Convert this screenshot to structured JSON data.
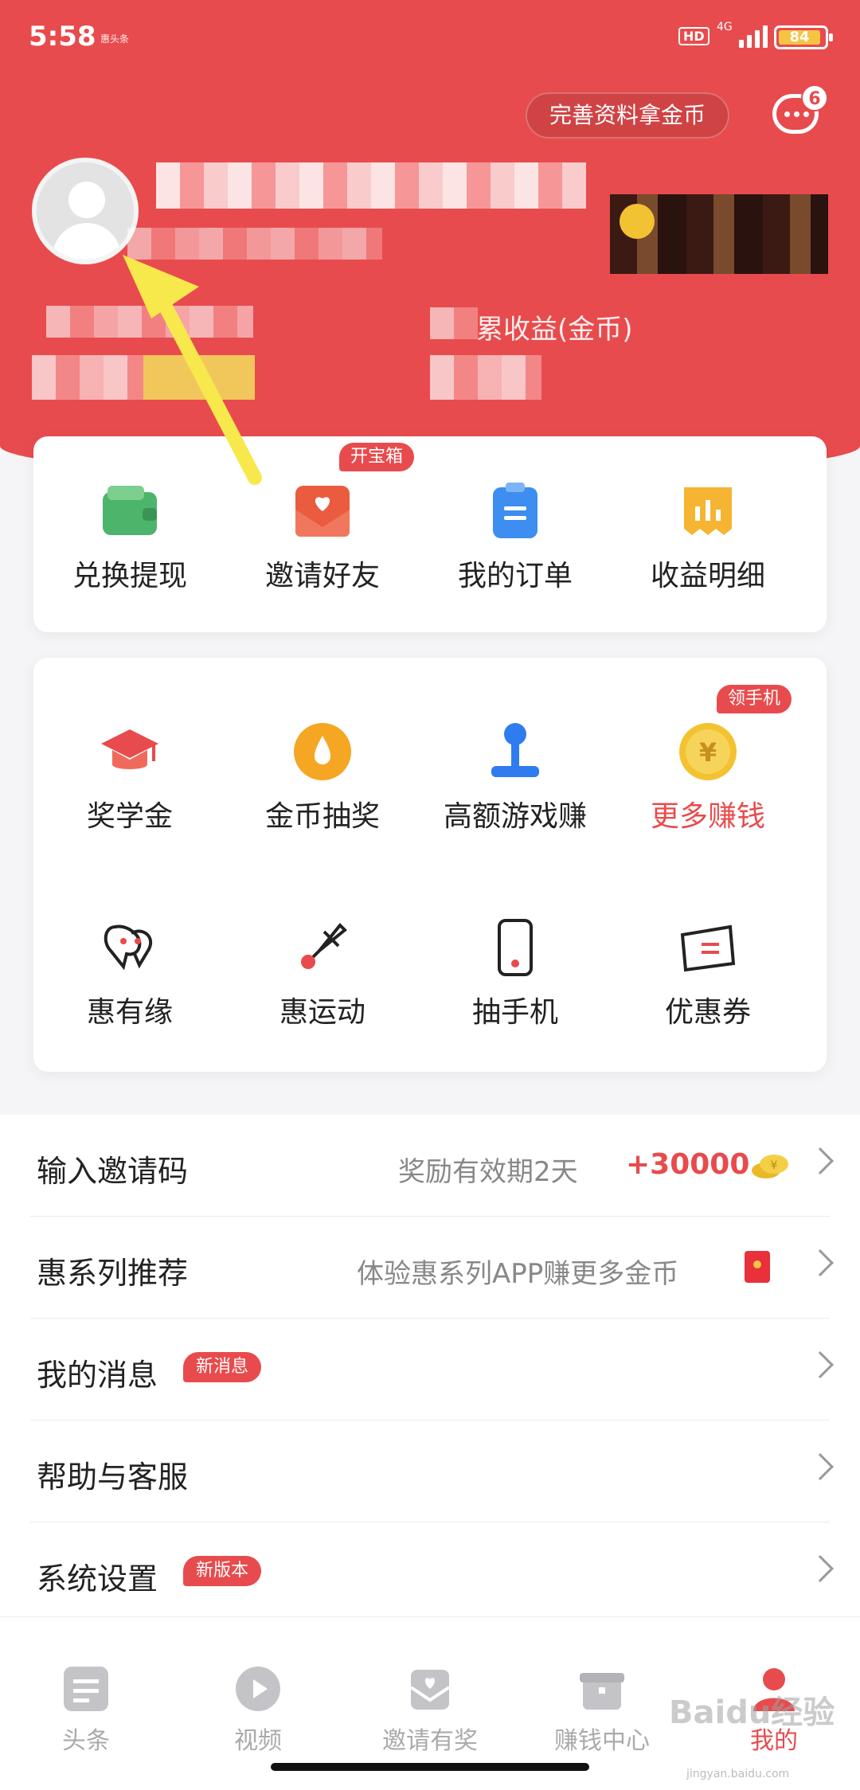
{
  "status_bar": {
    "time": "5:58",
    "carrier_note": "惠头条",
    "hd": "HD",
    "network": "4G",
    "battery": "84"
  },
  "header": {
    "complete_profile_label": "完善资料拿金币",
    "message_count": "6",
    "earnings_label": "累收益(金币)"
  },
  "quick_actions": [
    {
      "label": "兑换提现",
      "icon": "wallet-icon"
    },
    {
      "label": "邀请好友",
      "icon": "envelope-heart-icon",
      "tag": "开宝箱"
    },
    {
      "label": "我的订单",
      "icon": "clipboard-icon"
    },
    {
      "label": "收益明细",
      "icon": "chart-receipt-icon"
    }
  ],
  "features": [
    {
      "label": "奖学金",
      "icon": "graduation-cap-icon"
    },
    {
      "label": "金币抽奖",
      "icon": "drop-coin-icon"
    },
    {
      "label": "高额游戏赚",
      "icon": "joystick-icon"
    },
    {
      "label": "更多赚钱",
      "icon": "yen-coin-icon",
      "tag": "领手机"
    },
    {
      "label": "惠有缘",
      "icon": "heart-balloon-icon"
    },
    {
      "label": "惠运动",
      "icon": "shuttlecock-icon"
    },
    {
      "label": "抽手机",
      "icon": "phone-icon"
    },
    {
      "label": "优惠券",
      "icon": "coupon-icon"
    }
  ],
  "list": [
    {
      "title": "输入邀请码",
      "hint": "奖励有效期2天",
      "reward": "+30000"
    },
    {
      "title": "惠系列推荐",
      "hint": "体验惠系列APP赚更多金币"
    },
    {
      "title": "我的消息",
      "badge": "新消息"
    },
    {
      "title": "帮助与客服"
    },
    {
      "title": "系统设置",
      "badge": "新版本"
    }
  ],
  "nav": [
    {
      "label": "头条",
      "icon": "news-icon"
    },
    {
      "label": "视频",
      "icon": "play-icon"
    },
    {
      "label": "邀请有奖",
      "icon": "invite-icon"
    },
    {
      "label": "赚钱中心",
      "icon": "gift-box-icon"
    },
    {
      "label": "我的",
      "icon": "user-icon",
      "active": true
    }
  ],
  "watermark": {
    "text": "Baidu经验",
    "sub": "jingyan.baidu.com"
  },
  "colors": {
    "brand": "#e84b4d",
    "accent_yellow": "#f6c343"
  }
}
